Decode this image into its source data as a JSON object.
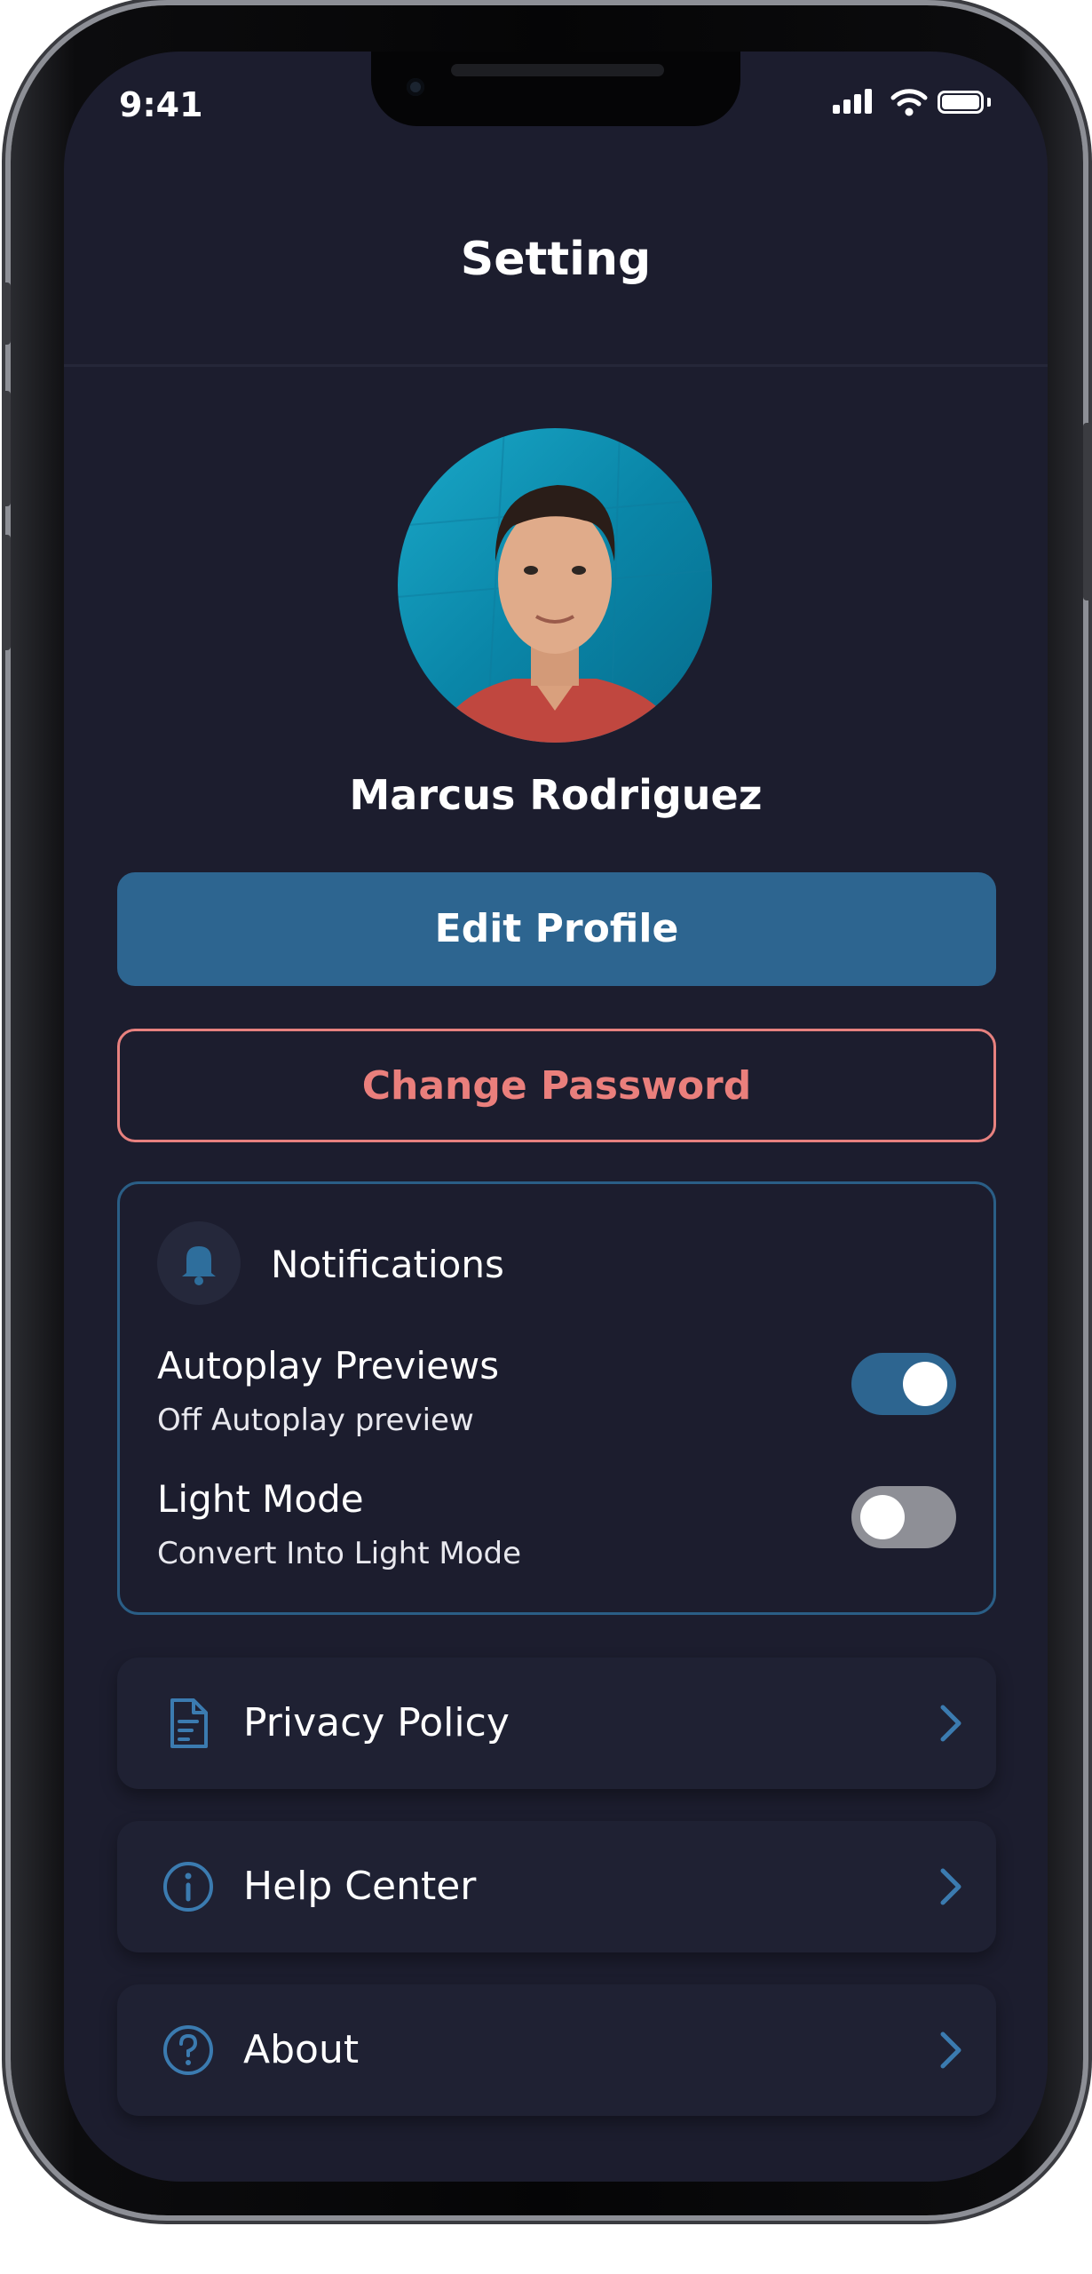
{
  "status_bar": {
    "time": "9:41"
  },
  "header": {
    "title": "Setting"
  },
  "profile": {
    "name": "Marcus Rodriguez"
  },
  "actions": {
    "edit_profile": "Edit Profile",
    "change_password": "Change Password"
  },
  "notifications": {
    "title": "Notifications",
    "settings": [
      {
        "title": "Autoplay Previews",
        "subtitle": "Off Autoplay preview",
        "on": true
      },
      {
        "title": "Light Mode",
        "subtitle": "Convert Into Light Mode",
        "on": false
      }
    ]
  },
  "menu": [
    {
      "label": "Privacy Policy",
      "icon": "document-icon"
    },
    {
      "label": "Help Center",
      "icon": "info-icon"
    },
    {
      "label": "About",
      "icon": "question-icon"
    }
  ],
  "colors": {
    "background": "#1c1d2e",
    "accent": "#2d6590",
    "danger": "#ea7f7c",
    "toggle_off": "#8e8f96"
  }
}
